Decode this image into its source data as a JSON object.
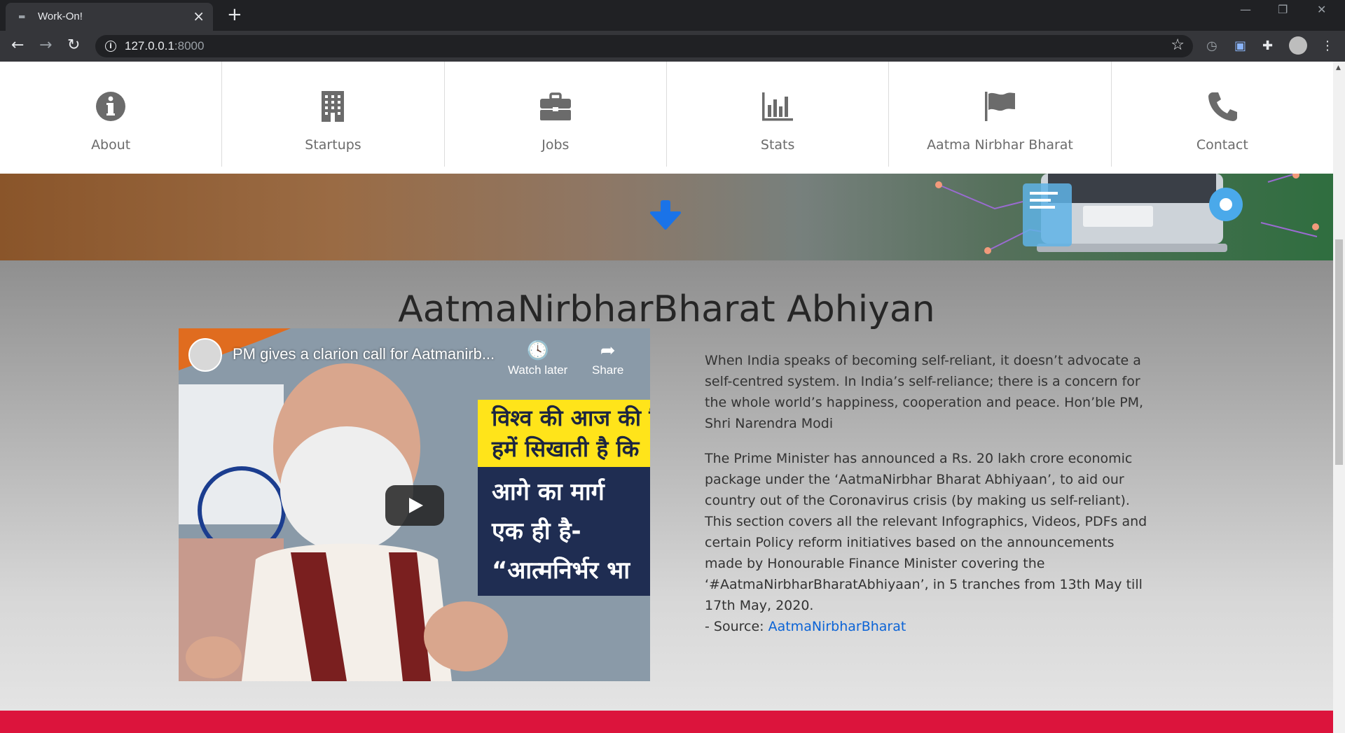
{
  "browser": {
    "tab_title": "Work-On!",
    "tab_close": "×",
    "new_tab": "+",
    "url_host": "127.0.0.1",
    "url_port": ":8000",
    "window_controls": [
      "—",
      "❐",
      "✕"
    ]
  },
  "nav": {
    "items": [
      {
        "label": "About",
        "icon": "info-icon"
      },
      {
        "label": "Startups",
        "icon": "building-icon"
      },
      {
        "label": "Jobs",
        "icon": "briefcase-icon"
      },
      {
        "label": "Stats",
        "icon": "bar-chart-icon"
      },
      {
        "label": "Aatma Nirbhar Bharat",
        "icon": "flag-icon"
      },
      {
        "label": "Contact",
        "icon": "phone-icon"
      }
    ]
  },
  "section": {
    "heading": "AatmaNirbharBharat Abhiyan",
    "video": {
      "title": "PM gives a clarion call for Aatmanirb...",
      "watch_later": "Watch later",
      "share": "Share",
      "hindi_lines_yellow": [
        "विश्व की आज की सि",
        "हमें सिखाती है कि"
      ],
      "hindi_lines_navy": [
        "आगे का मार्ग",
        "एक ही है-",
        "“आत्मनिर्भर भा"
      ]
    },
    "paragraph1": "When India speaks of becoming self-reliant, it doesn’t advocate a self-centred system. In India’s self-reliance; there is a concern for the whole world’s happiness, cooperation and peace. Hon’ble PM, Shri Narendra Modi",
    "paragraph2": "The Prime Minister has announced a Rs. 20 lakh crore economic package under the ‘AatmaNirbhar Bharat Abhiyaan’, to aid our country out of the Coronavirus crisis (by making us self-reliant). This section covers all the relevant Infographics, Videos, PDFs and certain Policy reform initiatives based on the announcements made by Honourable Finance Minister covering the ‘#AatmaNirbharBharatAbhiyaan’, in 5 tranches from 13th May till 17th May, 2020.",
    "source_prefix": "- Source: ",
    "source_link": "AatmaNirbharBharat"
  },
  "colors": {
    "accent_blue": "#1a73e8",
    "footer_red": "#dc143c",
    "link": "#0b63d6"
  }
}
